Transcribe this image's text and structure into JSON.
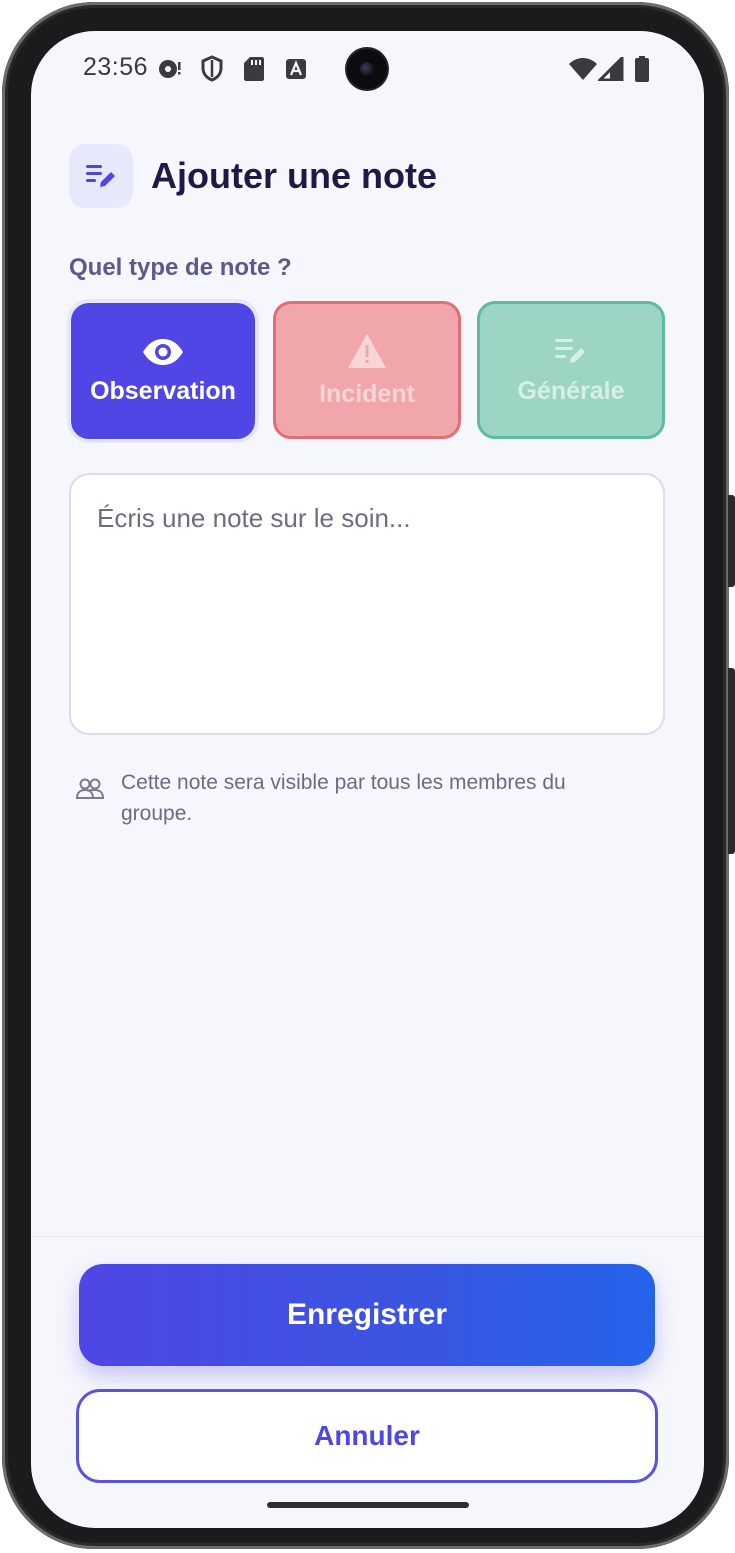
{
  "status_bar": {
    "time": "23:56",
    "left_icons": [
      "chat-bubble-icon",
      "shield-icon",
      "sd-card-icon",
      "font-a-icon"
    ],
    "right_icons": [
      "wifi-icon",
      "cellular-signal-icon",
      "battery-icon"
    ]
  },
  "header": {
    "title": "Ajouter une note",
    "icon": "notes-edit-icon"
  },
  "note_type": {
    "question": "Quel type de note ?",
    "selected": "Observation",
    "options": [
      {
        "label": "Observation",
        "icon": "eye-icon",
        "color": "#4F46E5"
      },
      {
        "label": "Incident",
        "icon": "warning-icon",
        "color": "#E46C72"
      },
      {
        "label": "Générale",
        "icon": "notes-edit-icon",
        "color": "#5CBC9D"
      }
    ]
  },
  "note_input": {
    "placeholder": "Écris une note sur le soin...",
    "value": ""
  },
  "visibility_hint": {
    "icon": "group-icon",
    "text": "Cette note sera visible par tous les membres du groupe."
  },
  "actions": {
    "save_label": "Enregistrer",
    "cancel_label": "Annuler"
  },
  "colors": {
    "accent": "#4F46E5",
    "accent_end": "#2563EB",
    "title": "#1D1A45",
    "background": "#F6F7FC"
  }
}
